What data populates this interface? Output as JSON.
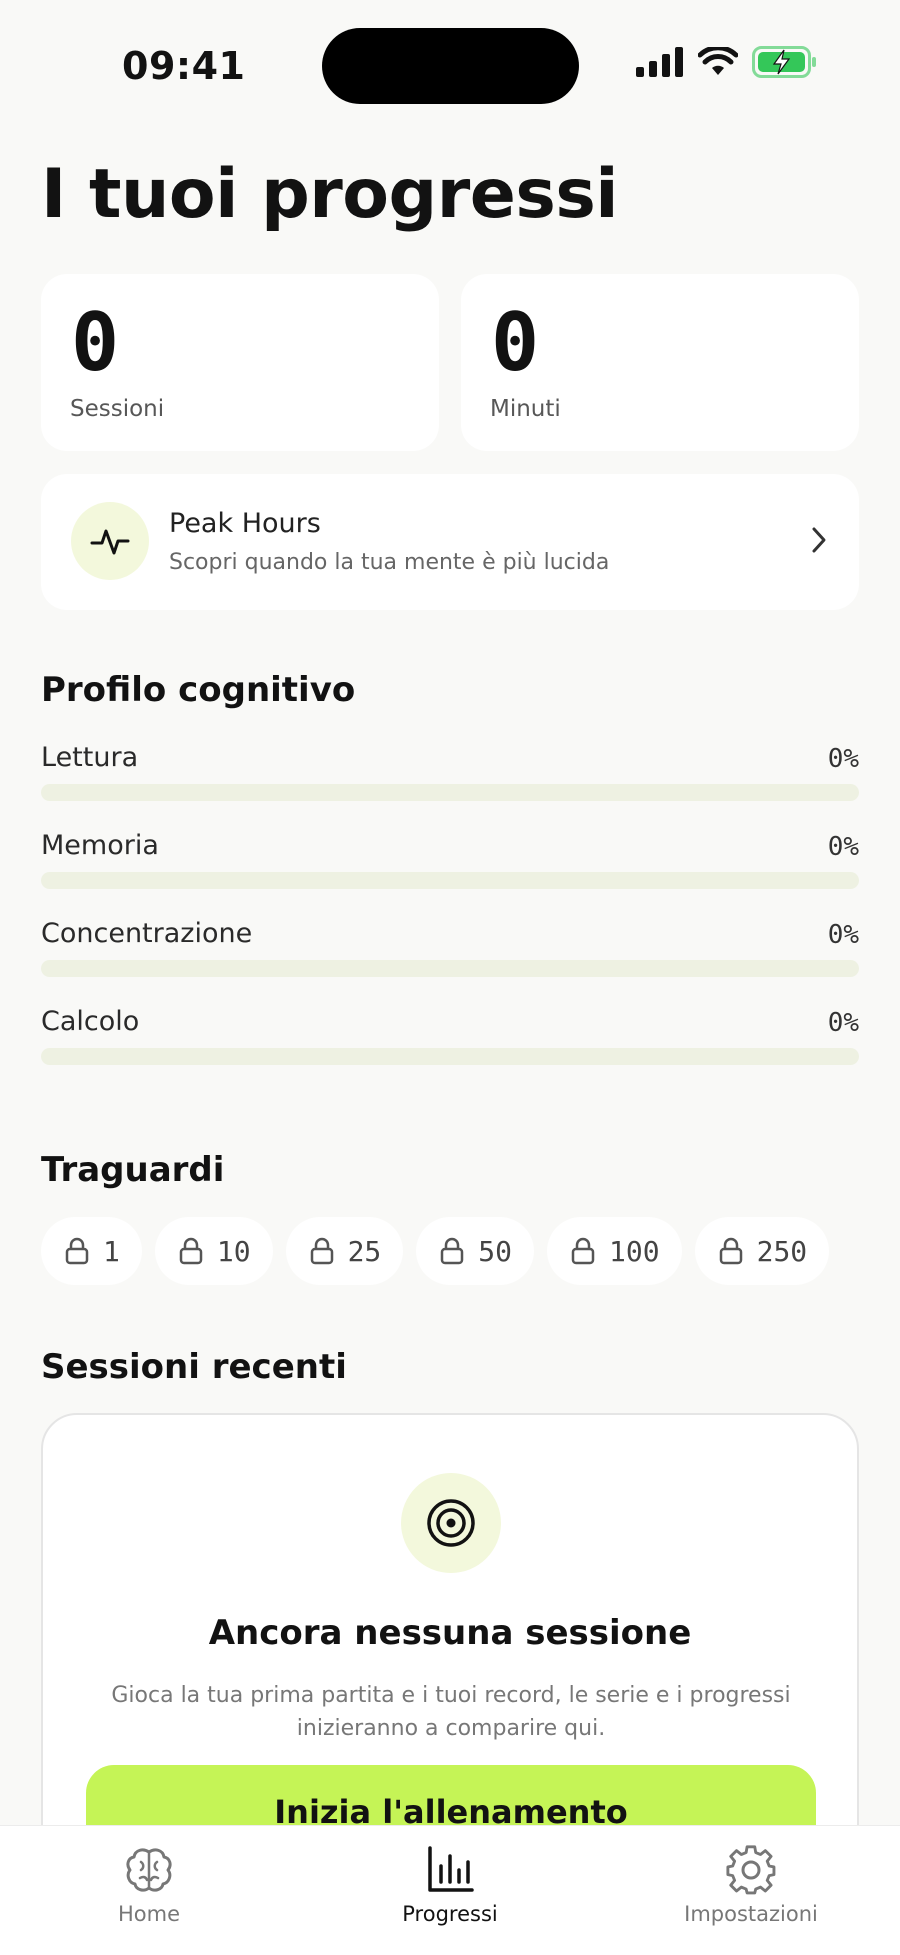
{
  "status_bar": {
    "time": "09:41"
  },
  "title": "I tuoi progressi",
  "stats": [
    {
      "value": "0",
      "label": "Sessioni"
    },
    {
      "value": "0",
      "label": "Minuti"
    }
  ],
  "peak_hours": {
    "title": "Peak Hours",
    "subtitle": "Scopri quando la tua mente è più lucida",
    "icon": "activity-icon"
  },
  "cognitive_profile": {
    "title": "Profilo cognitivo",
    "items": [
      {
        "label": "Lettura",
        "value": "0%",
        "progress": 0
      },
      {
        "label": "Memoria",
        "value": "0%",
        "progress": 0
      },
      {
        "label": "Concentrazione",
        "value": "0%",
        "progress": 0
      },
      {
        "label": "Calcolo",
        "value": "0%",
        "progress": 0
      }
    ]
  },
  "milestones": {
    "title": "Traguardi",
    "items": [
      "1",
      "10",
      "25",
      "50",
      "100",
      "250"
    ],
    "icon": "lock-icon"
  },
  "recent_sessions": {
    "title": "Sessioni recenti",
    "empty_title": "Ancora nessuna sessione",
    "empty_description": "Gioca la tua prima partita e i tuoi record, le serie e i progressi inizieranno a comparire qui.",
    "cta_label": "Inizia l'allenamento",
    "icon": "target-icon"
  },
  "tab_bar": {
    "tabs": [
      {
        "label": "Home",
        "icon": "brain-icon",
        "active": false
      },
      {
        "label": "Progressi",
        "icon": "bar-chart-icon",
        "active": true
      },
      {
        "label": "Impostazioni",
        "icon": "gear-icon",
        "active": false
      }
    ]
  },
  "colors": {
    "accent": "#c5f456",
    "accent_soft": "#f3f8dc",
    "track": "#eef1e2",
    "background": "#f9f9f7",
    "battery": "#34c759"
  }
}
